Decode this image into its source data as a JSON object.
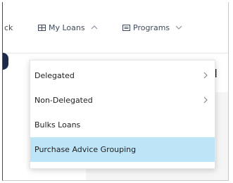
{
  "nav": {
    "back_partial": "ck",
    "loans_label": "My Loans",
    "programs_label": "Programs"
  },
  "background": {
    "partial_heading": "ol"
  },
  "dropdown": {
    "items": [
      {
        "label": "Delegated",
        "has_submenu": true
      },
      {
        "label": "Non-Delegated",
        "has_submenu": true
      },
      {
        "label": "Bulks Loans",
        "has_submenu": false
      },
      {
        "label": "Purchase Advice Grouping",
        "has_submenu": false,
        "highlighted": true
      }
    ],
    "highlight_color": "#bde4f7"
  },
  "icons": {
    "loans": "loans-grid-icon",
    "programs": "programs-list-icon",
    "chevron_up": "chevron-up-icon",
    "chevron_down": "chevron-down-icon",
    "chevron_right": "chevron-right-icon"
  }
}
